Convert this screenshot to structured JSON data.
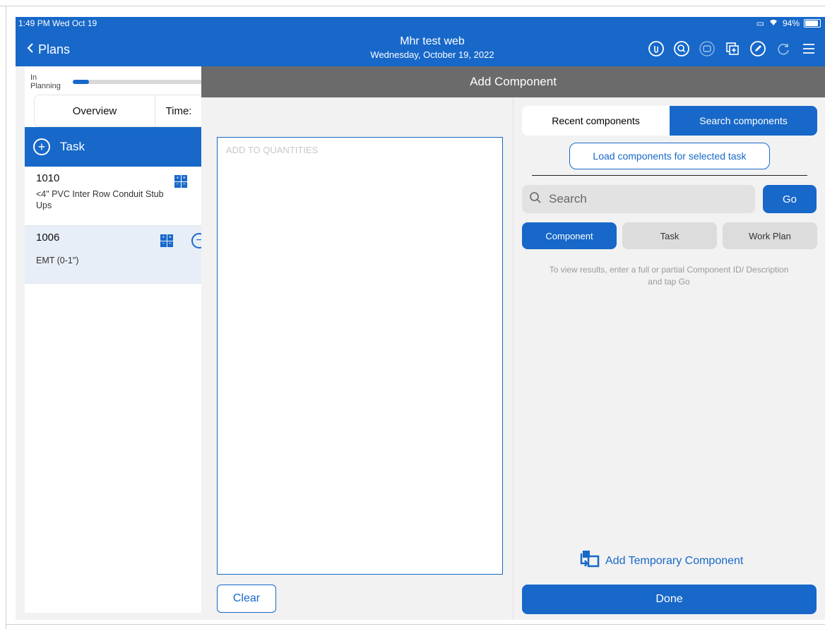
{
  "status_bar": {
    "time_date": "1:49 PM  Wed Oct 19",
    "battery": "94%"
  },
  "header": {
    "back_label": "Plans",
    "title": "Mhr test web",
    "subtitle": "Wednesday, October 19, 2022",
    "icons": [
      "attachment-icon",
      "search-circle-icon",
      "contact-icon",
      "add-copy-icon",
      "edit-icon",
      "sync-icon",
      "menu-icon"
    ]
  },
  "left_panel": {
    "progress_label": "In Planning",
    "progress_fraction": 0.12,
    "tabs": [
      "Overview",
      "Time:"
    ],
    "task_header": "Task",
    "tasks": [
      {
        "id": "1010",
        "description": "<4\" PVC Inter Row Conduit Stub Ups"
      },
      {
        "id": "1006",
        "description": "EMT (0-1\")"
      }
    ]
  },
  "modal": {
    "title": "Add Component",
    "quantities_placeholder": "ADD TO QUANTITIES",
    "clear_label": "Clear",
    "segments": [
      "Recent components",
      "Search components"
    ],
    "active_segment": "Search components",
    "load_button": "Load components for selected task",
    "search_placeholder": "Search",
    "go_label": "Go",
    "filters": [
      "Component",
      "Task",
      "Work Plan"
    ],
    "active_filter": "Component",
    "hint": "To view results, enter a full or partial Component ID/ Description and tap Go",
    "temp_component_label": "Add Temporary Component",
    "done_label": "Done"
  },
  "colors": {
    "primary": "#1768c9",
    "modal_header": "#6b6b6b",
    "background": "#f2f2f2"
  }
}
